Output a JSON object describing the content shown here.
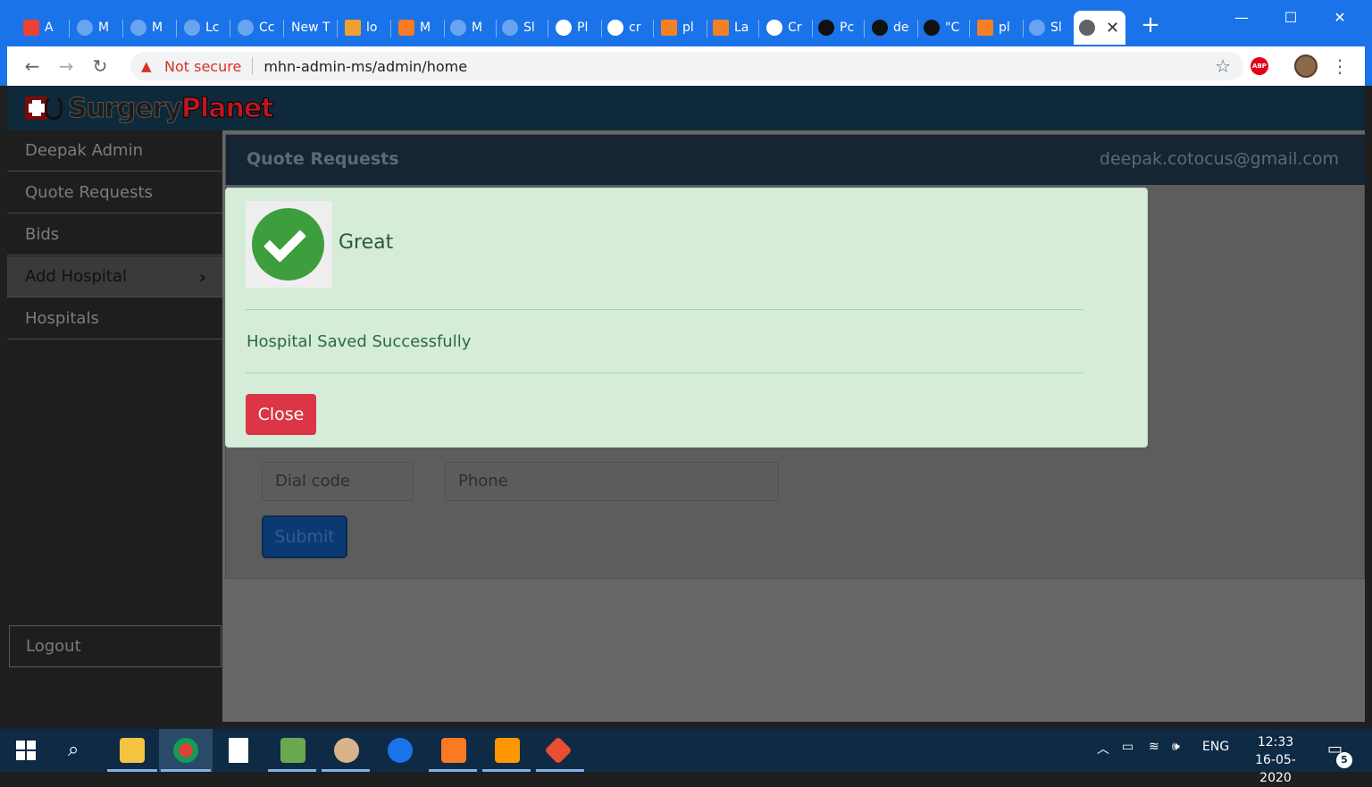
{
  "browser": {
    "tabs": [
      {
        "label": "A"
      },
      {
        "label": "M"
      },
      {
        "label": "M"
      },
      {
        "label": "Lc"
      },
      {
        "label": "Cc"
      },
      {
        "label": "New T"
      },
      {
        "label": "lo"
      },
      {
        "label": "M"
      },
      {
        "label": "M"
      },
      {
        "label": "Sl"
      },
      {
        "label": "Pl"
      },
      {
        "label": "cr"
      },
      {
        "label": "pl"
      },
      {
        "label": "La"
      },
      {
        "label": "Cr"
      },
      {
        "label": "Pc"
      },
      {
        "label": "de"
      },
      {
        "label": "\"C"
      },
      {
        "label": "pl"
      },
      {
        "label": "Sl"
      }
    ],
    "security_label": "Not secure",
    "url": "mhn-admin-ms/admin/home"
  },
  "app": {
    "logo": {
      "word1": "Surgery",
      "word2": "Planet"
    },
    "sidebar": {
      "items": [
        {
          "label": "Deepak Admin"
        },
        {
          "label": "Quote Requests"
        },
        {
          "label": "Bids"
        },
        {
          "label": "Add Hospital",
          "active": true
        },
        {
          "label": "Hospitals"
        }
      ],
      "logout_label": "Logout"
    },
    "panel": {
      "title": "Quote Requests",
      "user_email": "deepak.cotocus@gmail.com"
    },
    "form": {
      "dial_code_placeholder": "Dial code",
      "phone_placeholder": "Phone",
      "submit_label": "Submit"
    },
    "modal": {
      "title": "Great",
      "message": "Hospital Saved Successfully",
      "close_label": "Close"
    }
  },
  "taskbar": {
    "language": "ENG",
    "time": "12:33",
    "date": "16-05-2020",
    "notification_count": "5"
  },
  "colors": {
    "browser_blue": "#1a73e8",
    "app_header": "#0e2a3a",
    "modal_bg": "#d5ecd9",
    "close_button": "#dc3545",
    "success_green": "#3d9e3e"
  }
}
